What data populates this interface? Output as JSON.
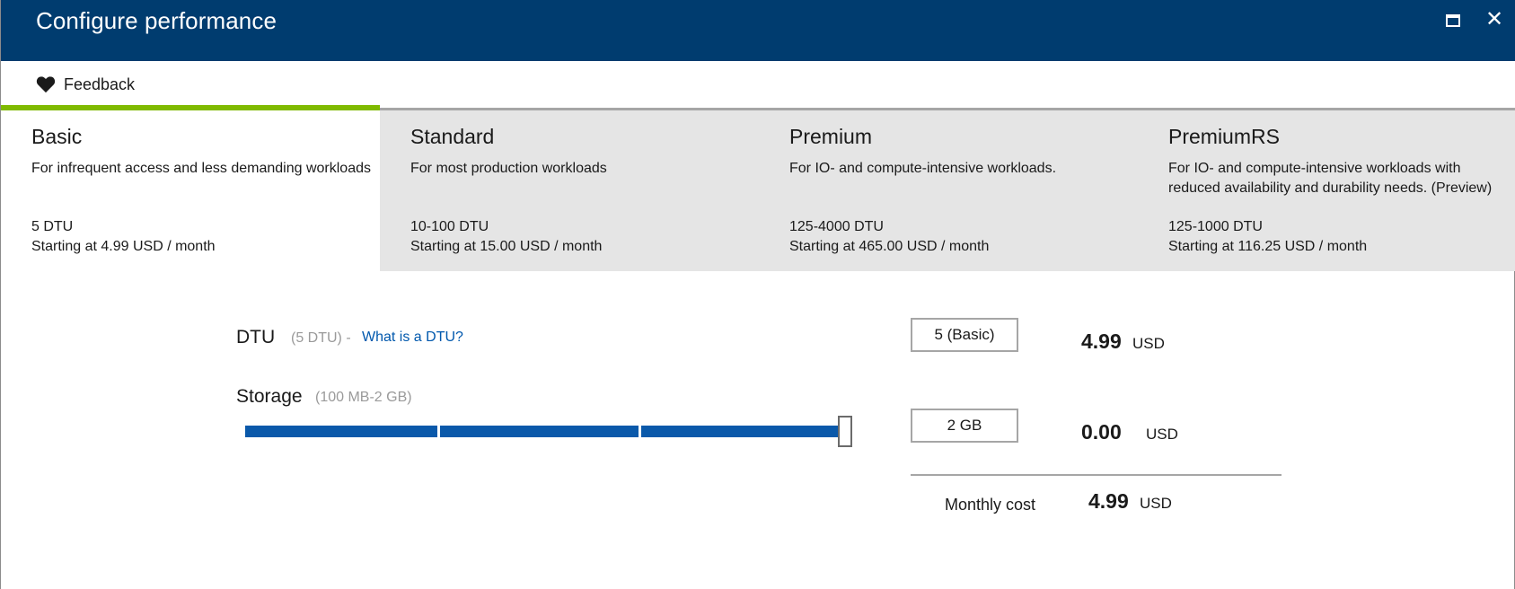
{
  "window": {
    "title": "Configure performance",
    "maximize_icon": "maximize-icon",
    "close_icon": "close-icon",
    "close_glyph": "✕"
  },
  "commandbar": {
    "feedback_label": "Feedback",
    "feedback_icon": "heart-icon"
  },
  "colors": {
    "titlebar": "#003c6f",
    "selected_accent": "#7fba00",
    "slider_fill": "#0a59aa",
    "link": "#0058ad"
  },
  "tiers": [
    {
      "name": "Basic",
      "description": "For infrequent access and less demanding workloads",
      "dtu": "5 DTU",
      "price": "Starting at 4.99 USD / month",
      "selected": true
    },
    {
      "name": "Standard",
      "description": "For most production workloads",
      "dtu": "10-100 DTU",
      "price": "Starting at 15.00 USD / month",
      "selected": false
    },
    {
      "name": "Premium",
      "description": "For IO- and compute-intensive workloads.",
      "dtu": "125-4000 DTU",
      "price": "Starting at 465.00 USD / month",
      "selected": false
    },
    {
      "name": "PremiumRS",
      "description": "For IO- and compute-intensive workloads with reduced availability and durability needs. (Preview)",
      "dtu": "125-1000 DTU",
      "price": "Starting at 116.25 USD / month",
      "selected": false
    }
  ],
  "config": {
    "dtu": {
      "label": "DTU",
      "range": "(5 DTU) -",
      "help_link": "What is a DTU?",
      "value": "5 (Basic)",
      "price": "4.99",
      "currency": "USD"
    },
    "storage": {
      "label": "Storage",
      "range": "(100 MB-2 GB)",
      "value": "2 GB",
      "slider_level": 1.0,
      "price": "0.00",
      "currency": "USD"
    },
    "monthly": {
      "label": "Monthly cost",
      "price": "4.99",
      "currency": "USD"
    }
  }
}
